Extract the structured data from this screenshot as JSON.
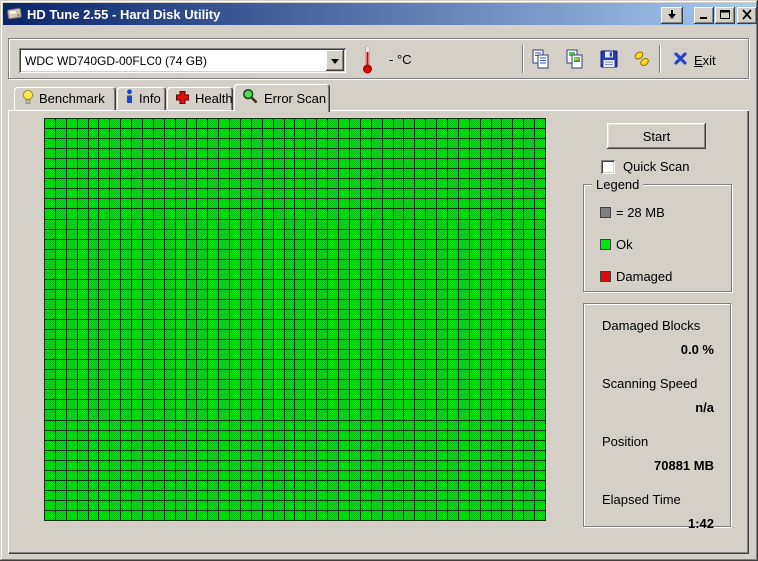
{
  "window": {
    "title": "HD Tune 2.55 - Hard Disk Utility"
  },
  "toolbar": {
    "drive_selector": {
      "value": "WDC WD740GD-00FLC0 (74 GB)"
    },
    "temperature": "- °C",
    "exit": {
      "accel": "E",
      "rest": "xit"
    }
  },
  "tabs": [
    {
      "label": "Benchmark",
      "active": false
    },
    {
      "label": "Info",
      "active": false
    },
    {
      "label": "Health",
      "active": false
    },
    {
      "label": "Error Scan",
      "active": true
    }
  ],
  "error_scan": {
    "start_button": "Start",
    "quick_scan": {
      "label": "Quick Scan",
      "checked": false
    },
    "legend": {
      "title": "Legend",
      "items": [
        {
          "color": "#808080",
          "label": "= 28 MB"
        },
        {
          "color": "#00e414",
          "label": "Ok"
        },
        {
          "color": "#de0b0b",
          "label": "Damaged"
        }
      ]
    },
    "stats": [
      {
        "label": "Damaged Blocks",
        "value": "0.0 %"
      },
      {
        "label": "Scanning Speed",
        "value": "n/a"
      },
      {
        "label": "Position",
        "value": "70881 MB"
      },
      {
        "label": "Elapsed Time",
        "value": "1:42"
      }
    ],
    "grid": {
      "columns": 46,
      "rows": 40,
      "all_blocks_status": "ok",
      "colors": {
        "ok": "#00e414",
        "ok_dither": "#00c110",
        "gridline": "#0c330c"
      }
    }
  },
  "colors": {
    "titlebar_left": "#0a246a",
    "titlebar_right": "#a6caf0",
    "window_bg": "#d4d0c8"
  }
}
